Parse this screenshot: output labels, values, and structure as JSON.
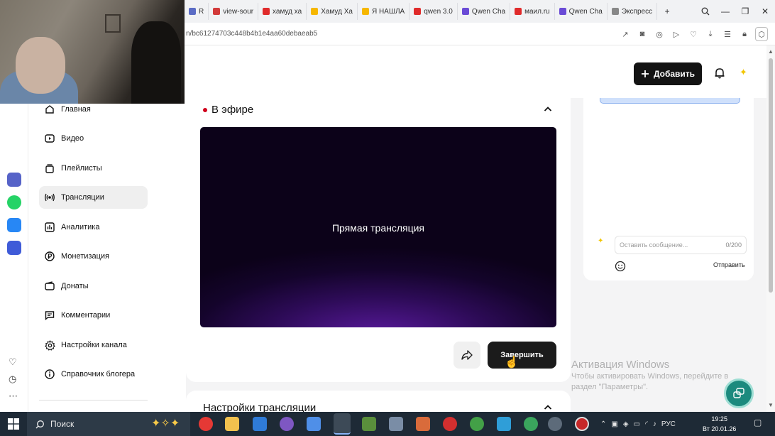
{
  "browser": {
    "tabs": [
      {
        "label": "R",
        "color": "#5b6cc5"
      },
      {
        "label": "view-sour",
        "color": "#d23a3a"
      },
      {
        "label": "хамуд ха",
        "color": "#e02b2b"
      },
      {
        "label": "Хамуд Ха",
        "color": "#f6b700"
      },
      {
        "label": "Я НАШЛА",
        "color": "#f6b700"
      },
      {
        "label": "qwen 3.0",
        "color": "#e02b2b"
      },
      {
        "label": "Qwen Cha",
        "color": "#6a4bd6"
      },
      {
        "label": "маил.ru",
        "color": "#e02b2b"
      },
      {
        "label": "Qwen Cha",
        "color": "#6a4bd6"
      },
      {
        "label": "Экспресс",
        "color": "#888888"
      }
    ],
    "url": "n/bc61274703c448b4b1e4aa60debaeab5"
  },
  "header": {
    "add_label": "Добавить"
  },
  "sidebar": {
    "items": [
      {
        "label": "Главная"
      },
      {
        "label": "Видео"
      },
      {
        "label": "Плейлисты"
      },
      {
        "label": "Трансляции"
      },
      {
        "label": "Аналитика"
      },
      {
        "label": "Монетизация"
      },
      {
        "label": "Донаты"
      },
      {
        "label": "Комментарии"
      },
      {
        "label": "Настройки канала"
      },
      {
        "label": "Справочник блогера"
      }
    ]
  },
  "live": {
    "title": "В эфире",
    "player_label": "Прямая трансляция",
    "finish_label": "Завершить"
  },
  "settings": {
    "title": "Настройки трансляции"
  },
  "chat": {
    "placeholder": "Оставить сообщение...",
    "counter": "0/200",
    "send_label": "Отправить"
  },
  "windows": {
    "activate_title": "Активация Windows",
    "activate_line1": "Чтобы активировать Windows, перейдите в",
    "activate_line2": "раздел \"Параметры\"."
  },
  "taskbar": {
    "search_label": "Поиск",
    "lang": "РУС",
    "time": "19:25",
    "date": "Вт 20.01.26"
  },
  "colors": {
    "accent": "#131313",
    "live_dot": "#d0021b",
    "player_purple": "#5a1a9e"
  }
}
